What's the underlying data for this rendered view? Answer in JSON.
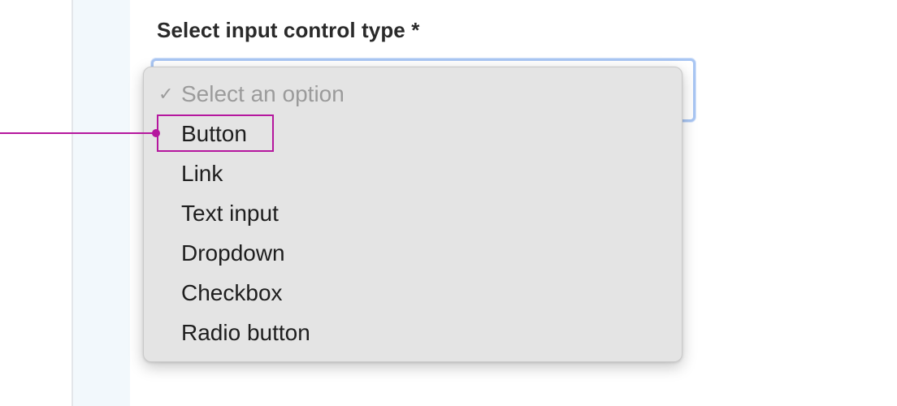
{
  "form": {
    "field_label": "Select input control type *"
  },
  "dropdown": {
    "selected_marker": "✓",
    "placeholder": "Select an option",
    "options": [
      "Button",
      "Link",
      "Text input",
      "Dropdown",
      "Checkbox",
      "Radio button"
    ],
    "highlighted_option": "Button"
  },
  "colors": {
    "annotation": "#b5179e",
    "focus_ring": "#a9c6f3",
    "menu_background": "#e4e4e4"
  },
  "icons": {
    "selected_marker": "checkmark-icon"
  }
}
